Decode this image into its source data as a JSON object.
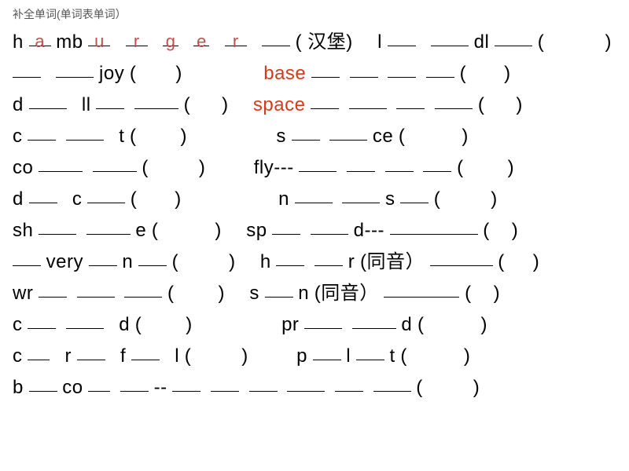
{
  "title": "补全单词(单词表单词）",
  "answers": {
    "a": "a",
    "u": "u",
    "r": "r",
    "g": "g",
    "e": "e",
    "r2": "r"
  },
  "hints": {
    "hanbao": "汉堡",
    "tongyin": "同音"
  },
  "stems": {
    "h": "h",
    "mb": "mb",
    "l": "l",
    "dl": "dl",
    "joy": "joy",
    "base": "base",
    "d": "d",
    "ll": "ll",
    "space": "space",
    "c": "c",
    "t": "t",
    "s": "s",
    "ce": "ce",
    "co": "co",
    "fly": "fly---",
    "n": "n",
    "sh": "sh",
    "e2": "e",
    "sp": "sp",
    "ddash": "d---",
    "very": "very",
    "r3": "r",
    "wr": "wr",
    "pr": "pr",
    "f": "f",
    "p": "p",
    "b": "b"
  }
}
